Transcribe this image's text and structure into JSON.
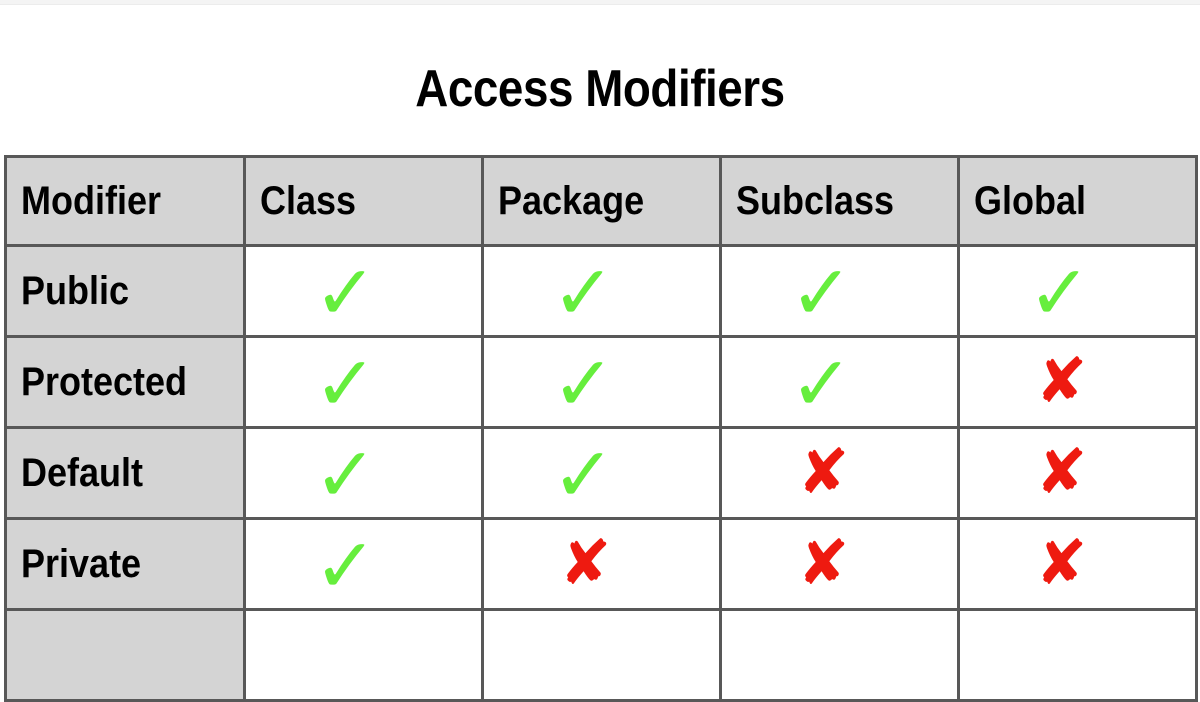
{
  "page": {
    "title": "Access Modifiers",
    "background_color": "#ffffff"
  },
  "colors": {
    "header_background": "#d4d4d4",
    "row_label_background": "#d4d4d4",
    "cell_background": "#ffffff",
    "border": "#585858",
    "check_green": "#66ee3d",
    "cross_red": "#ee1a10",
    "text": "#000000"
  },
  "table": {
    "columns": [
      {
        "key": "modifier",
        "label": "Modifier"
      },
      {
        "key": "class",
        "label": "Class"
      },
      {
        "key": "package",
        "label": "Package"
      },
      {
        "key": "subclass",
        "label": "Subclass"
      },
      {
        "key": "global",
        "label": "Global"
      }
    ],
    "glyphs": {
      "yes": "✓",
      "no": "✘"
    },
    "rows": [
      {
        "modifier": "Public",
        "class": "yes",
        "package": "yes",
        "subclass": "yes",
        "global": "yes"
      },
      {
        "modifier": "Protected",
        "class": "yes",
        "package": "yes",
        "subclass": "yes",
        "global": "no"
      },
      {
        "modifier": "Default",
        "class": "yes",
        "package": "yes",
        "subclass": "no",
        "global": "no"
      },
      {
        "modifier": "Private",
        "class": "yes",
        "package": "no",
        "subclass": "no",
        "global": "no"
      },
      {
        "modifier": "",
        "class": "",
        "package": "",
        "subclass": "",
        "global": ""
      }
    ]
  }
}
